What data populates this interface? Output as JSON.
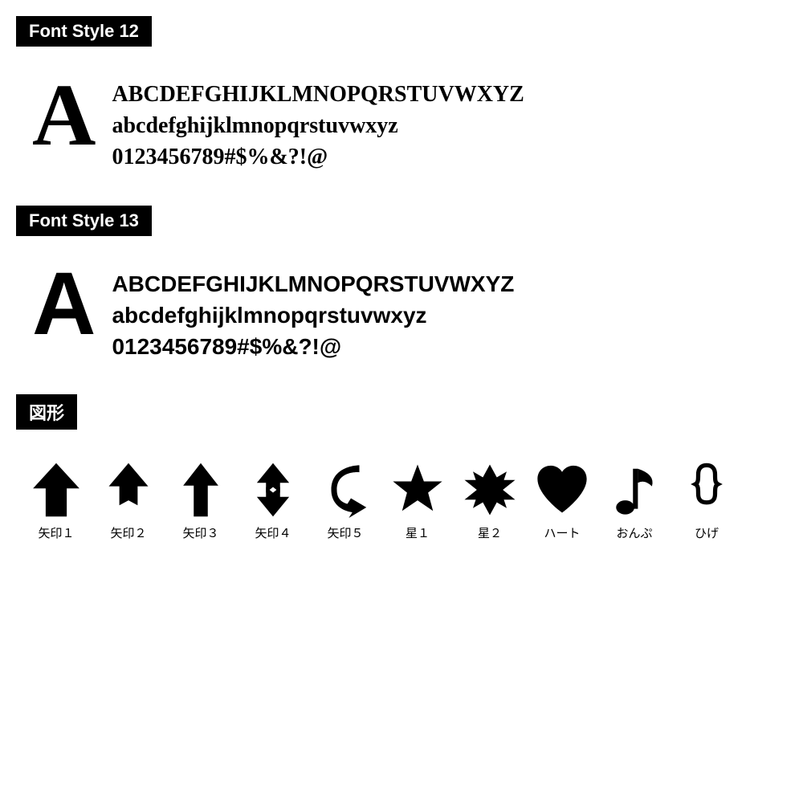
{
  "fontStyle12": {
    "label": "Font Style 12",
    "bigLetter": "A",
    "lines": [
      "ABCDEFGHIJKLMNOPQRSTUVWXYZ",
      "abcdefghijklmnopqrstuvwxyz",
      "0123456789#$%&?!@"
    ]
  },
  "fontStyle13": {
    "label": "Font Style 13",
    "bigLetter": "A",
    "lines": [
      "ABCDEFGHIJKLMNOPQRSTUVWXYZ",
      "abcdefghijklmnopqrstuvwxyz",
      "0123456789#$%&?!@"
    ]
  },
  "shapes": {
    "label": "図形",
    "items": [
      {
        "id": "arrow1",
        "label": "矢印１"
      },
      {
        "id": "arrow2",
        "label": "矢印２"
      },
      {
        "id": "arrow3",
        "label": "矢印３"
      },
      {
        "id": "arrow4",
        "label": "矢印４"
      },
      {
        "id": "arrow5",
        "label": "矢印５"
      },
      {
        "id": "star1",
        "label": "星１"
      },
      {
        "id": "star2",
        "label": "星２"
      },
      {
        "id": "heart",
        "label": "ハート"
      },
      {
        "id": "music",
        "label": "おんぷ"
      },
      {
        "id": "moustache",
        "label": "ひげ"
      }
    ]
  }
}
